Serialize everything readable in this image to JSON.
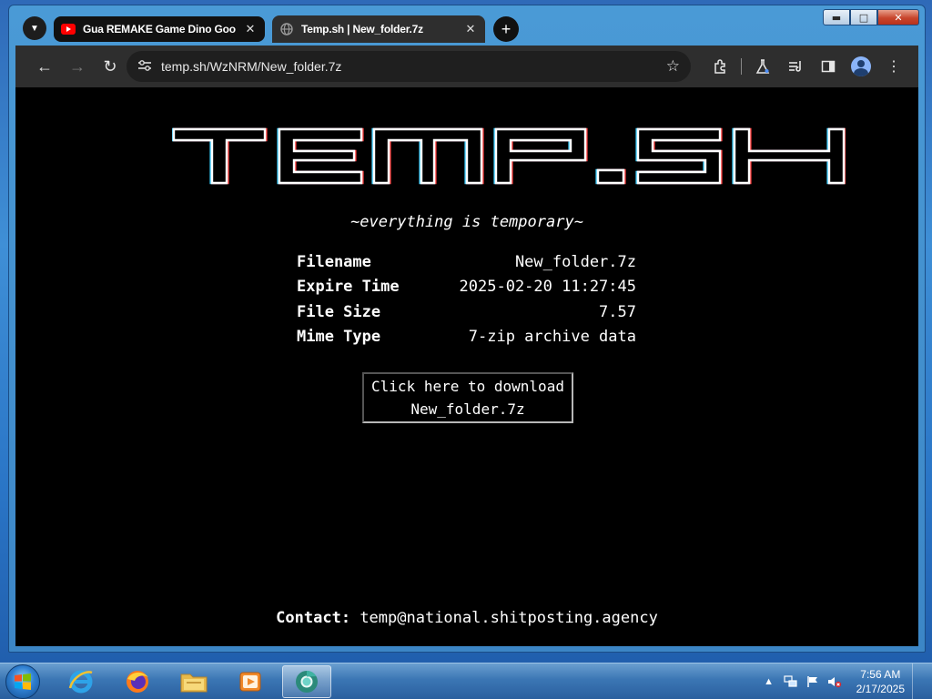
{
  "browser": {
    "tabs": [
      {
        "title": "Gua REMAKE Game Dino Goog",
        "favicon": "youtube-icon",
        "active": false
      },
      {
        "title": "Temp.sh | New_folder.7z",
        "favicon": "globe-icon",
        "active": true
      }
    ],
    "url": "temp.sh/WzNRM/New_folder.7z"
  },
  "page": {
    "logo_text": "TEMP.SH",
    "tagline": "~everything is temporary~",
    "file_info": [
      {
        "label": "Filename",
        "value": "New_folder.7z"
      },
      {
        "label": "Expire Time",
        "value": "2025-02-20 11:27:45"
      },
      {
        "label": "File Size",
        "value": "7.57"
      },
      {
        "label": "Mime Type",
        "value": "7-zip archive data"
      }
    ],
    "download_button": {
      "line1": "Click here to download",
      "line2": "New_folder.7z"
    },
    "contact": {
      "label": "Contact:",
      "email": "temp@national.shitposting.agency"
    }
  },
  "taskbar": {
    "apps": [
      "internet-explorer-icon",
      "firefox-icon",
      "file-explorer-icon",
      "media-player-icon",
      "chrome-icon"
    ],
    "clock": {
      "time": "7:56 AM",
      "date": "2/17/2025"
    }
  }
}
